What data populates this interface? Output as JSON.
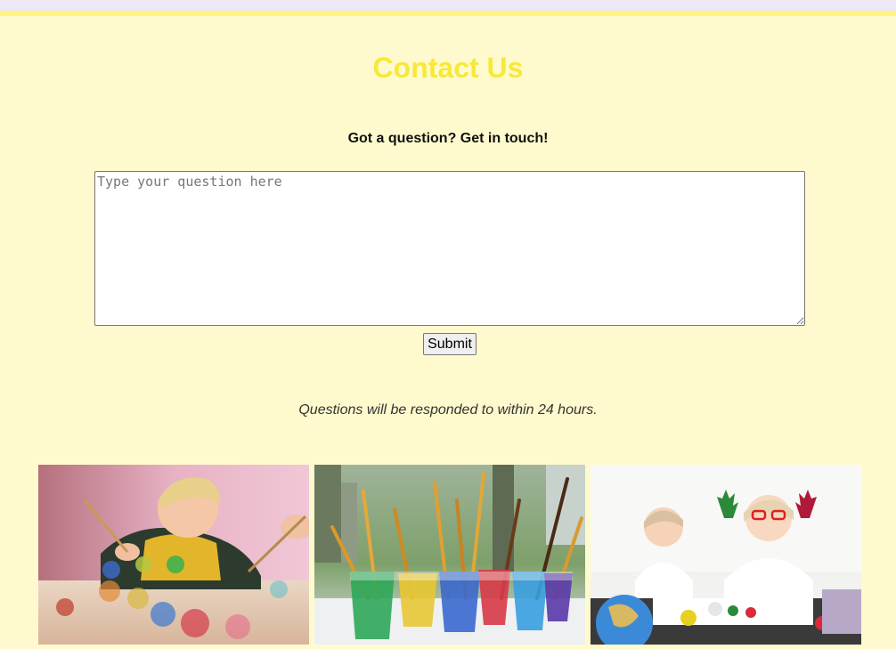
{
  "page": {
    "title": "Contact Us",
    "subtitle": "Got a question? Get in touch!",
    "note": "Questions will be responded to within 24 hours."
  },
  "form": {
    "question_placeholder": "Type your question here",
    "question_value": "",
    "submit_label": "Submit"
  },
  "gallery": {
    "images": [
      {
        "name": "boy-painting-photo"
      },
      {
        "name": "paint-brushes-in-cups-photo"
      },
      {
        "name": "girls-with-painted-hands-photo"
      }
    ]
  },
  "colors": {
    "background": "#fffacd",
    "title": "#f8e83a",
    "top_strip": "#ece8f8",
    "top_line": "#fff480"
  }
}
